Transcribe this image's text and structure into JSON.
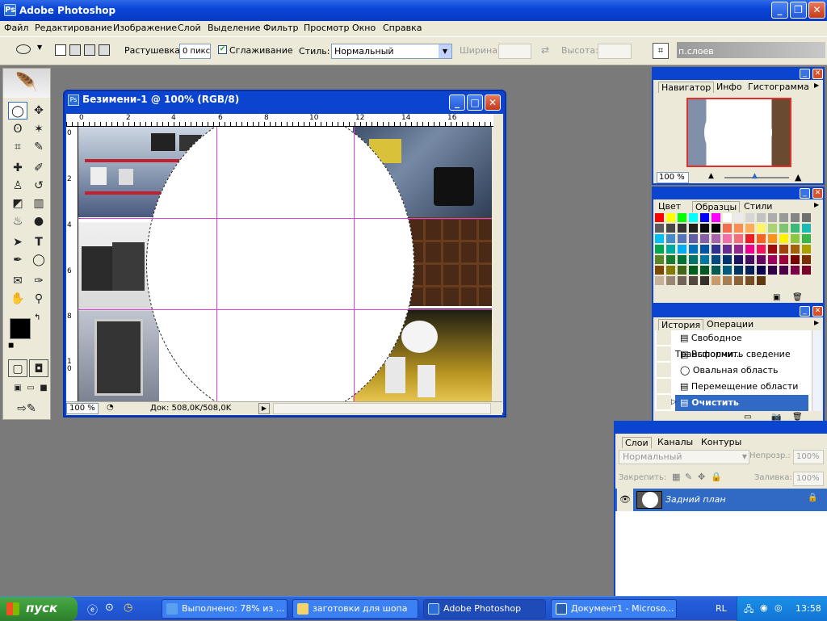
{
  "app": {
    "title": "Adobe Photoshop"
  },
  "menu": [
    "Файл",
    "Редактирование",
    "Изображение",
    "Слой",
    "Выделение",
    "Фильтр",
    "Просмотр",
    "Окно",
    "Справка"
  ],
  "options": {
    "feather_label": "Растушевка:",
    "feather_value": "0 пикс",
    "antialias_label": "Сглаживание",
    "style_label": "Стиль:",
    "style_value": "Нормальный",
    "width_label": "Ширина:",
    "height_label": "Высота:",
    "layers_tab": "п.слоев"
  },
  "document": {
    "title": "Безимени-1 @ 100% (RGB/8)",
    "zoom": "100 %",
    "doc_info": "Док: 508,0K/508,0K",
    "ruler_top": [
      "0",
      "2",
      "4",
      "6",
      "8",
      "10",
      "12",
      "14",
      "16"
    ],
    "ruler_left": [
      "0",
      "2",
      "4",
      "6",
      "8",
      "1 0"
    ]
  },
  "navigator": {
    "tabs": [
      "Навигатор",
      "Инфо",
      "Гистограмма"
    ],
    "zoom": "100 %"
  },
  "swatches": {
    "tabs": [
      "Цвет",
      "Образцы",
      "Стили"
    ],
    "rows": [
      [
        "#ff0000",
        "#ffff00",
        "#00ff00",
        "#00ffff",
        "#0000ff",
        "#ff00ff",
        "#ffffff",
        "#ebebeb",
        "#d6d6d6",
        "#c2c2c2",
        "#adadad",
        "#999999",
        "#858585",
        "#707070"
      ],
      [
        "#5c5c5c",
        "#474747",
        "#333333",
        "#1f1f1f",
        "#0a0a0a",
        "#000000",
        "#f26c4f",
        "#f68e55",
        "#fbad5c",
        "#fff467",
        "#acd372",
        "#7dc473",
        "#3cb878",
        "#1abbb4"
      ],
      [
        "#00bff3",
        "#438ccb",
        "#5574b9",
        "#605ca8",
        "#855fa8",
        "#a763a9",
        "#f06ea9",
        "#f26d7d",
        "#ed1c24",
        "#f26522",
        "#f7941d",
        "#fff200",
        "#8dc63f",
        "#39b54a"
      ],
      [
        "#00a651",
        "#00a99d",
        "#00aeef",
        "#0072bc",
        "#0054a5",
        "#2e3192",
        "#662d91",
        "#92278f",
        "#ec008c",
        "#ed145b",
        "#9e0b0f",
        "#a0410d",
        "#a3620a",
        "#aba000"
      ],
      [
        "#598527",
        "#197b30",
        "#007236",
        "#00746b",
        "#0076a3",
        "#004a80",
        "#003471",
        "#1b1464",
        "#440e62",
        "#630460",
        "#9e005d",
        "#9e0039",
        "#790000",
        "#7b2e00"
      ],
      [
        "#7d4900",
        "#827b00",
        "#406618",
        "#005e20",
        "#005826",
        "#005952",
        "#005b7f",
        "#003663",
        "#002157",
        "#0d004c",
        "#32004b",
        "#4b0049",
        "#7b0046",
        "#7a0026"
      ],
      [
        "#c7b299",
        "#998675",
        "#736357",
        "#534741",
        "#37302a",
        "#c69c6d",
        "#a67c52",
        "#8c6239",
        "#754c24",
        "#603913"
      ]
    ]
  },
  "history": {
    "tabs": [
      "История",
      "Операции"
    ],
    "items": [
      "Свободное Трансформи...",
      "Выполнить сведение",
      "Овальная область",
      "Перемещение области",
      "Очистить"
    ]
  },
  "layers": {
    "tabs": [
      "Слои",
      "Каналы",
      "Контуры"
    ],
    "blend_mode": "Нормальный",
    "opacity_label": "Непрозр.:",
    "opacity_value": "100%",
    "lock_label": "Закрепить:",
    "fill_label": "Заливка:",
    "fill_value": "100%",
    "layer_name": "Задний план"
  },
  "taskbar": {
    "start": "пуск",
    "buttons": [
      "Выполнено: 78% из ...",
      "заготовки для шопа",
      "Adobe Photoshop",
      "Документ1 - Microso..."
    ],
    "lang": "RL",
    "clock": "13:58"
  }
}
